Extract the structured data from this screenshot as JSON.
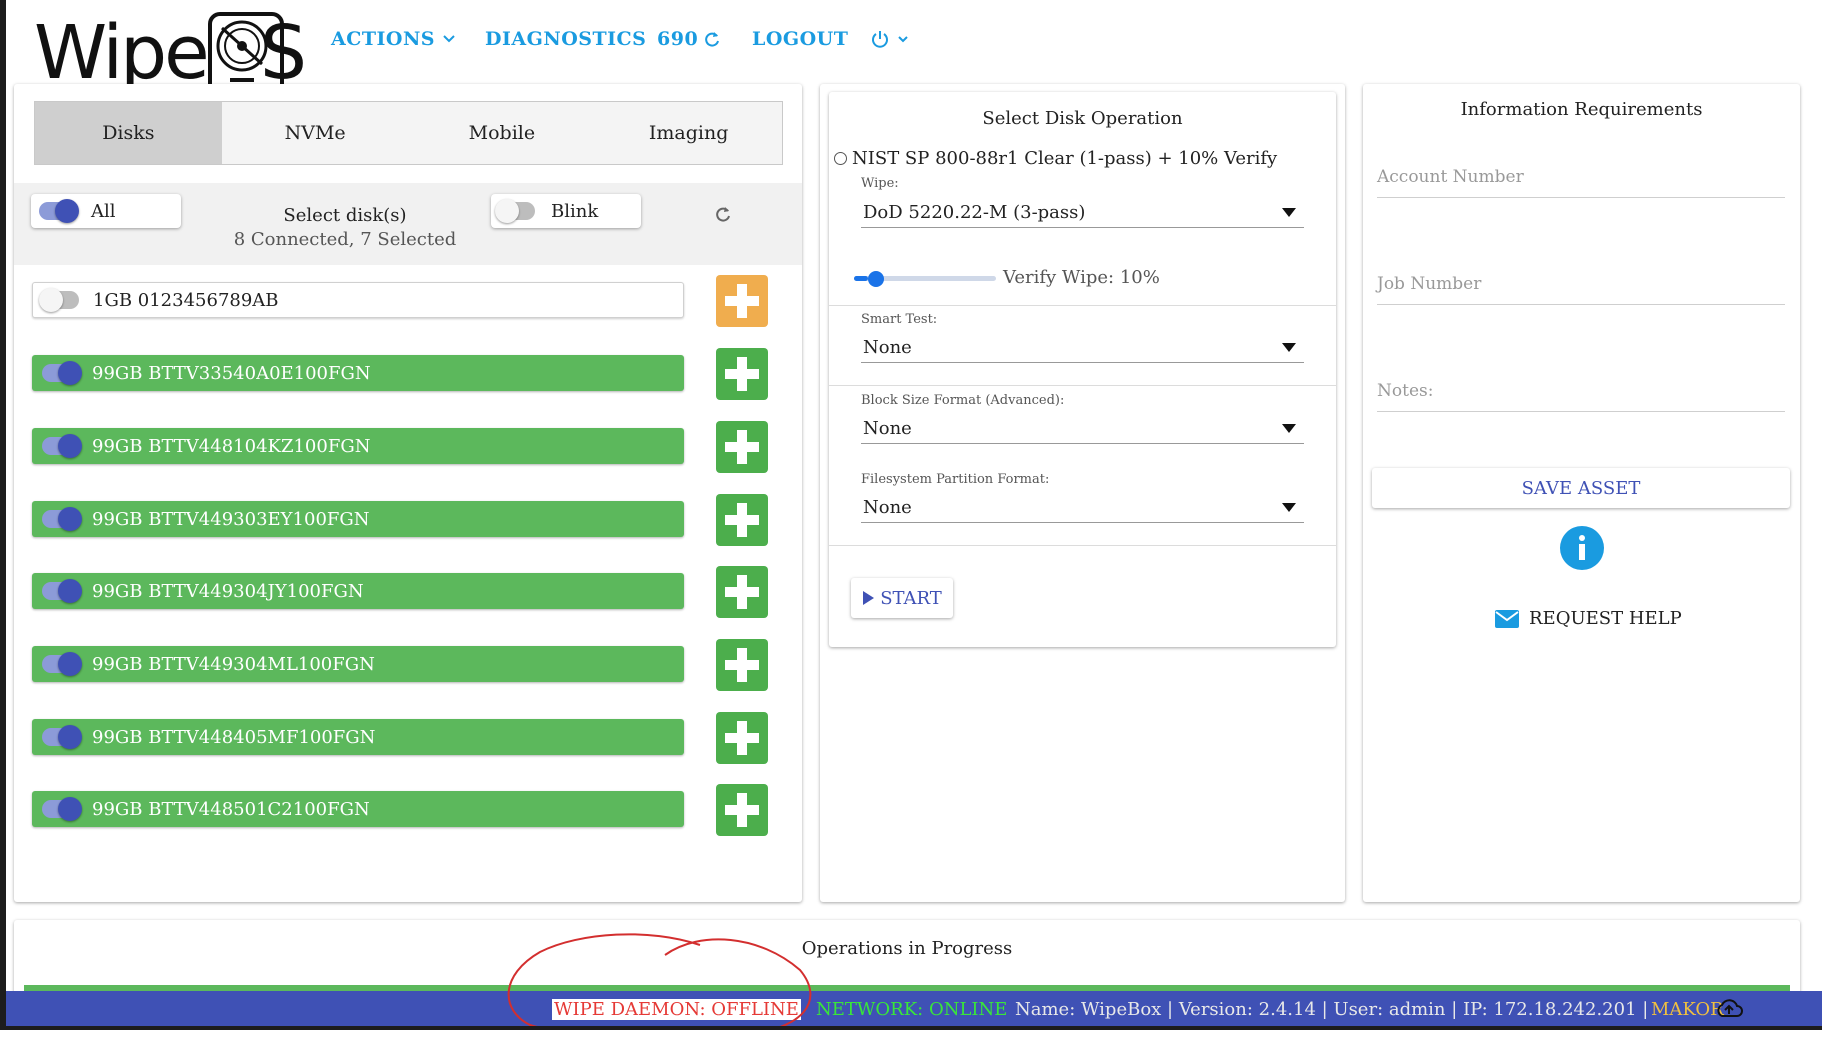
{
  "logo": {
    "text_left": "Wipe",
    "text_right": "S"
  },
  "nav": {
    "actions": "ACTIONS",
    "diagnostics": "DIAGNOSTICS",
    "counter": "690",
    "logout": "LOGOUT"
  },
  "tabs": [
    "Disks",
    "NVMe",
    "Mobile",
    "Imaging"
  ],
  "selection": {
    "all_label": "All",
    "title": "Select disk(s)",
    "summary": "8 Connected, 7 Selected",
    "blink_label": "Blink"
  },
  "disks": [
    {
      "label": "1GB 0123456789AB",
      "selected": false,
      "status": "white",
      "button_color": "#f0ad4e"
    },
    {
      "label": "99GB BTTV33540A0E100FGN",
      "selected": true,
      "status": "green",
      "button_color": "#4cae4c"
    },
    {
      "label": "99GB BTTV448104KZ100FGN",
      "selected": true,
      "status": "green",
      "button_color": "#4cae4c"
    },
    {
      "label": "99GB BTTV449303EY100FGN",
      "selected": true,
      "status": "green",
      "button_color": "#4cae4c"
    },
    {
      "label": "99GB BTTV449304JY100FGN",
      "selected": true,
      "status": "green",
      "button_color": "#4cae4c"
    },
    {
      "label": "99GB BTTV449304ML100FGN",
      "selected": true,
      "status": "green",
      "button_color": "#4cae4c"
    },
    {
      "label": "99GB BTTV448405MF100FGN",
      "selected": true,
      "status": "green",
      "button_color": "#4cae4c"
    },
    {
      "label": "99GB BTTV448501C2100FGN",
      "selected": true,
      "status": "green",
      "button_color": "#4cae4c"
    }
  ],
  "operation": {
    "title": "Select Disk Operation",
    "preset": "NIST SP 800-88r1 Clear (1-pass) + 10% Verify",
    "wipe_label": "Wipe:",
    "wipe_value": "DoD 5220.22-M (3-pass)",
    "verify_label": "Verify Wipe: 10%",
    "verify_fraction": 0.1,
    "smart_label": "Smart Test:",
    "smart_value": "None",
    "block_label": "Block Size Format (Advanced):",
    "block_value": "None",
    "fs_label": "Filesystem Partition Format:",
    "fs_value": "None",
    "start": "START"
  },
  "info": {
    "title": "Information Requirements",
    "account_placeholder": "Account Number",
    "job_placeholder": "Job Number",
    "notes_placeholder": "Notes:",
    "save": "SAVE ASSET",
    "help": "REQUEST HELP"
  },
  "operations": {
    "title": "Operations in Progress"
  },
  "status": {
    "daemon": "WIPE DAEMON: OFFLINE",
    "network": "NETWORK: ONLINE",
    "details": "Name: WipeBox | Version: 2.4.14 | User: admin | IP: 172.18.242.201 |",
    "brand": "MAKOR"
  },
  "colors": {
    "accent": "#1a9be0",
    "primary": "#3f51b5",
    "success": "#5cb85c",
    "warning": "#f0ad4e",
    "danger": "#e53935",
    "network": "#39e639",
    "brand": "#f0c040"
  }
}
